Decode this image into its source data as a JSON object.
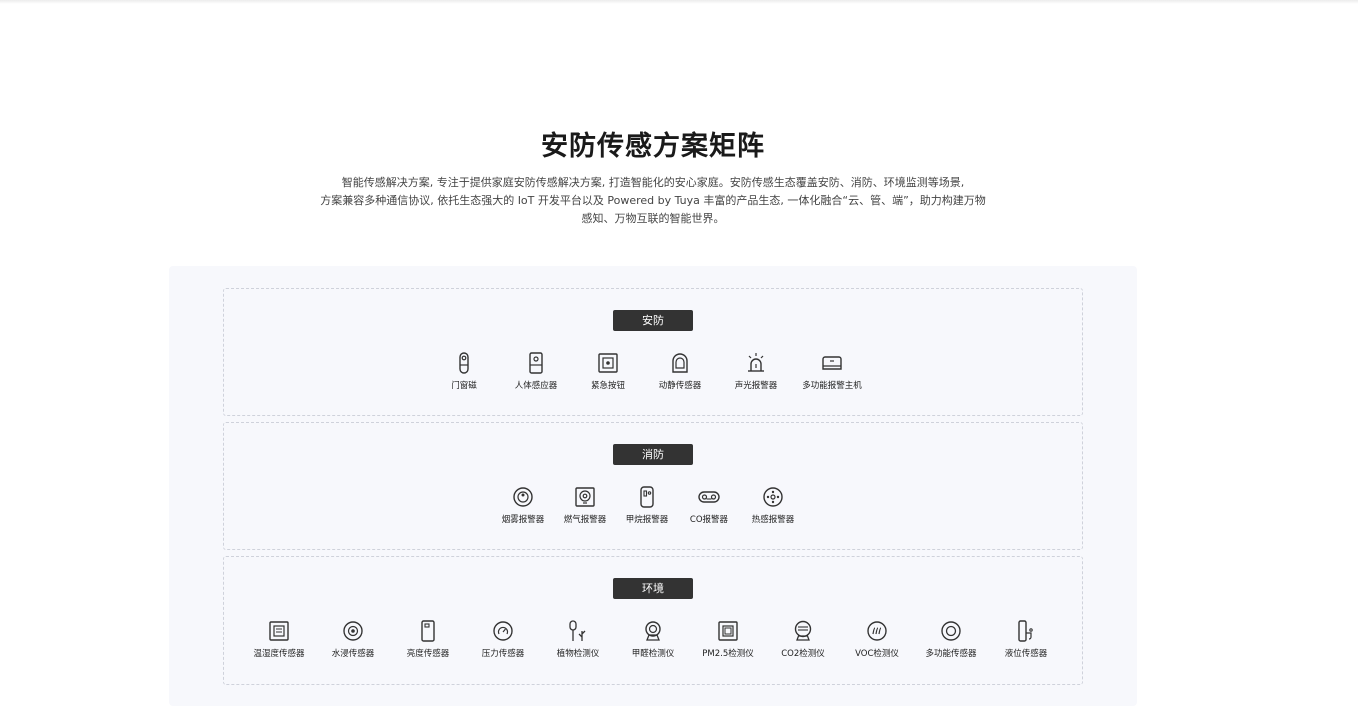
{
  "title": "安防传感方案矩阵",
  "description": {
    "line1": "智能传感解决方案, 专注于提供家庭安防传感解决方案, 打造智能化的安心家庭。安防传感生态覆盖安防、消防、环境监测等场景,",
    "line2": "方案兼容多种通信协议, 依托生态强大的 IoT 开发平台以及 Powered by Tuya 丰富的产品生态, 一体化融合“云、管、端”，助力构建万物",
    "line3": "感知、万物互联的智能世界。"
  },
  "groups": [
    {
      "tag": "安防",
      "items": [
        {
          "label": "门窗磁",
          "icon": "door-sensor-icon"
        },
        {
          "label": "人体感应器",
          "icon": "motion-sensor-icon"
        },
        {
          "label": "紧急按钮",
          "icon": "emergency-button-icon"
        },
        {
          "label": "动静传感器",
          "icon": "vibration-sensor-icon"
        },
        {
          "label": "声光报警器",
          "icon": "siren-icon"
        },
        {
          "label": "多功能报警主机",
          "icon": "alarm-hub-icon"
        }
      ]
    },
    {
      "tag": "消防",
      "items": [
        {
          "label": "烟雾报警器",
          "icon": "smoke-alarm-icon"
        },
        {
          "label": "燃气报警器",
          "icon": "gas-alarm-icon"
        },
        {
          "label": "甲烷报警器",
          "icon": "methane-alarm-icon"
        },
        {
          "label": "CO报警器",
          "icon": "co-alarm-icon"
        },
        {
          "label": "热感报警器",
          "icon": "heat-alarm-icon"
        }
      ]
    },
    {
      "tag": "环境",
      "items": [
        {
          "label": "温湿度传感器",
          "icon": "thermo-hygrometer-icon"
        },
        {
          "label": "水浸传感器",
          "icon": "water-leak-icon"
        },
        {
          "label": "亮度传感器",
          "icon": "light-sensor-icon"
        },
        {
          "label": "压力传感器",
          "icon": "pressure-sensor-icon"
        },
        {
          "label": "植物检测仪",
          "icon": "plant-monitor-icon"
        },
        {
          "label": "甲醛检测仪",
          "icon": "formaldehyde-detector-icon"
        },
        {
          "label": "PM2.5检测仪",
          "icon": "pm25-detector-icon"
        },
        {
          "label": "CO2检测仪",
          "icon": "co2-detector-icon"
        },
        {
          "label": "VOC检测仪",
          "icon": "voc-detector-icon"
        },
        {
          "label": "多功能传感器",
          "icon": "multi-sensor-icon"
        },
        {
          "label": "液位传感器",
          "icon": "liquid-level-icon"
        }
      ]
    }
  ]
}
